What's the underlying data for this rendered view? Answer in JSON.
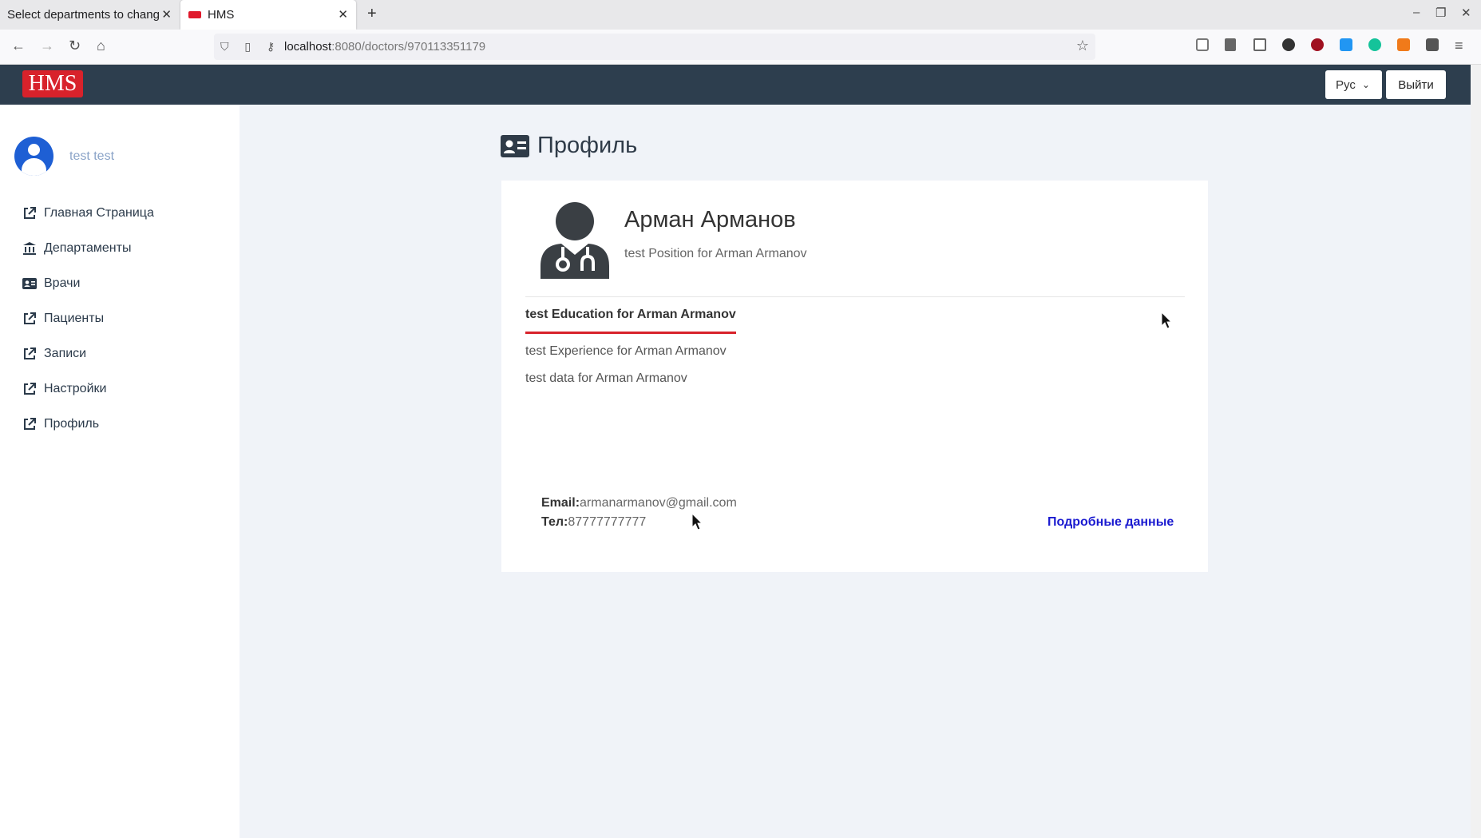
{
  "browser": {
    "tabs": [
      {
        "title": "Select departments to change",
        "active": false
      },
      {
        "title": "HMS",
        "active": true
      }
    ],
    "url_host": "localhost",
    "url_path": ":8080/doctors/970113351179"
  },
  "header": {
    "logo": "HMS",
    "language": "Рус",
    "logout": "Выйти"
  },
  "sidebar": {
    "user_name": "test test",
    "items": [
      {
        "label": "Главная Страница",
        "icon": "external-link-icon"
      },
      {
        "label": "Департаменты",
        "icon": "bank-icon"
      },
      {
        "label": "Врачи",
        "icon": "id-card-icon"
      },
      {
        "label": "Пациенты",
        "icon": "external-link-icon"
      },
      {
        "label": "Записи",
        "icon": "external-link-icon"
      },
      {
        "label": "Настройки",
        "icon": "external-link-icon"
      },
      {
        "label": "Профиль",
        "icon": "external-link-icon"
      }
    ]
  },
  "page": {
    "title": "Профиль"
  },
  "doctor": {
    "name": "Арман Арманов",
    "position": "test Position for Arman Armanov",
    "education": "test Education for Arman Armanov",
    "experience": "test Experience for Arman Armanov",
    "data": "test data for Arman Armanov",
    "email_label": "Email:",
    "email": "armanarmanov@gmail.com",
    "phone_label": "Тел:",
    "phone": "87777777777",
    "details_link": "Подробные данные"
  },
  "colors": {
    "header_bg": "#2d3e4e",
    "logo_bg": "#d8222b",
    "accent_link": "#1a1ad0",
    "avatar": "#1e5fd4"
  }
}
